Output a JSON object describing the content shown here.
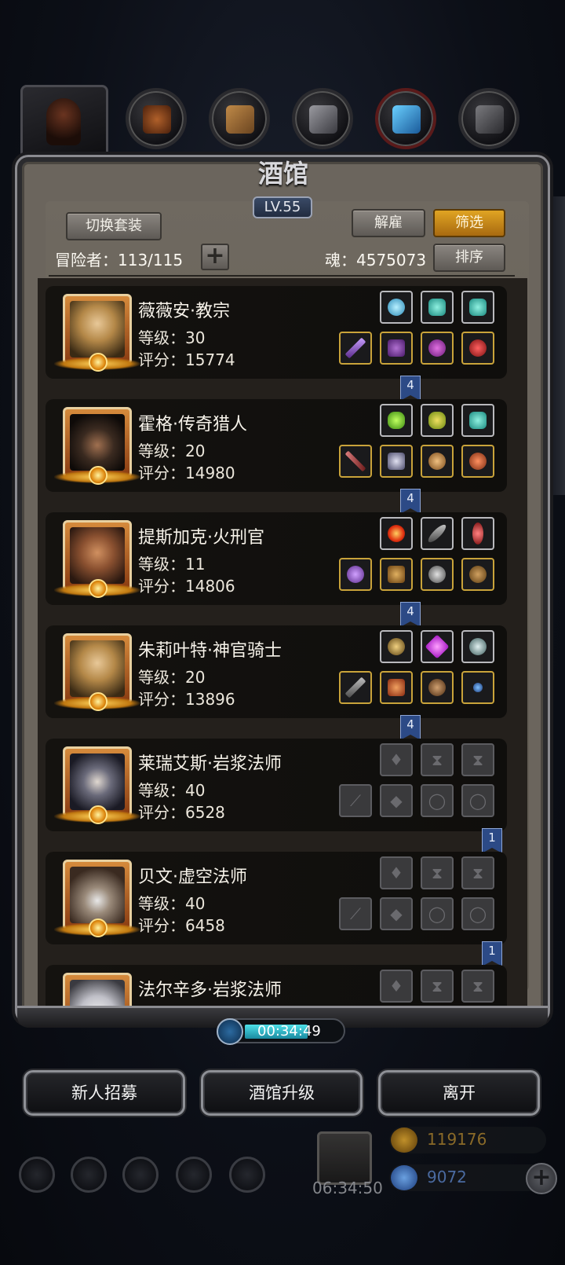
{
  "title": "酒馆",
  "level": "LV.55",
  "buttons": {
    "switch_outfit": "切换套装",
    "dismiss": "解雇",
    "filter": "筛选",
    "sort": "排序"
  },
  "adventurers": {
    "label": "冒险者：113/115",
    "plus": "+"
  },
  "soul": {
    "label": "魂：4575073"
  },
  "heroes": [
    {
      "name": "薇薇安·教宗",
      "level": "等级：30",
      "score": "评分：15774",
      "ribbon": "4",
      "empty_slots": false
    },
    {
      "name": "霍格·传奇猎人",
      "level": "等级：20",
      "score": "评分：14980",
      "ribbon": "4",
      "empty_slots": false
    },
    {
      "name": "提斯加克·火刑官",
      "level": "等级：11",
      "score": "评分：14806",
      "ribbon": "4",
      "empty_slots": false
    },
    {
      "name": "朱莉叶特·神官骑士",
      "level": "等级：20",
      "score": "评分：13896",
      "ribbon": "4",
      "empty_slots": false
    },
    {
      "name": "莱瑞艾斯·岩浆法师",
      "level": "等级：40",
      "score": "评分：6528",
      "ribbon": "1",
      "empty_slots": true
    },
    {
      "name": "贝文·虚空法师",
      "level": "等级：40",
      "score": "评分：6458",
      "ribbon": "1",
      "empty_slots": true
    },
    {
      "name": "法尔辛多·岩浆法师",
      "level": "",
      "score": "",
      "ribbon": "",
      "empty_slots": true
    }
  ],
  "timer": "00:34:49",
  "bottom": {
    "recruit": "新人招募",
    "upgrade": "酒馆升级",
    "leave": "离开"
  },
  "gift_timer": "06:34:50",
  "currency": {
    "gold": "119176",
    "gems": "9072"
  },
  "icons": [
    "gem-slot-icon",
    "weapon-icon",
    "armor-icon",
    "helmet-icon",
    "ring-icon",
    "amulet-icon",
    "fire-rune-icon",
    "hourglass-icon",
    "staff-icon"
  ],
  "colors": {
    "accent_gold": "#e0a423",
    "ribbon_blue": "#2c4a86",
    "timer_cyan": "#4de0e8"
  }
}
